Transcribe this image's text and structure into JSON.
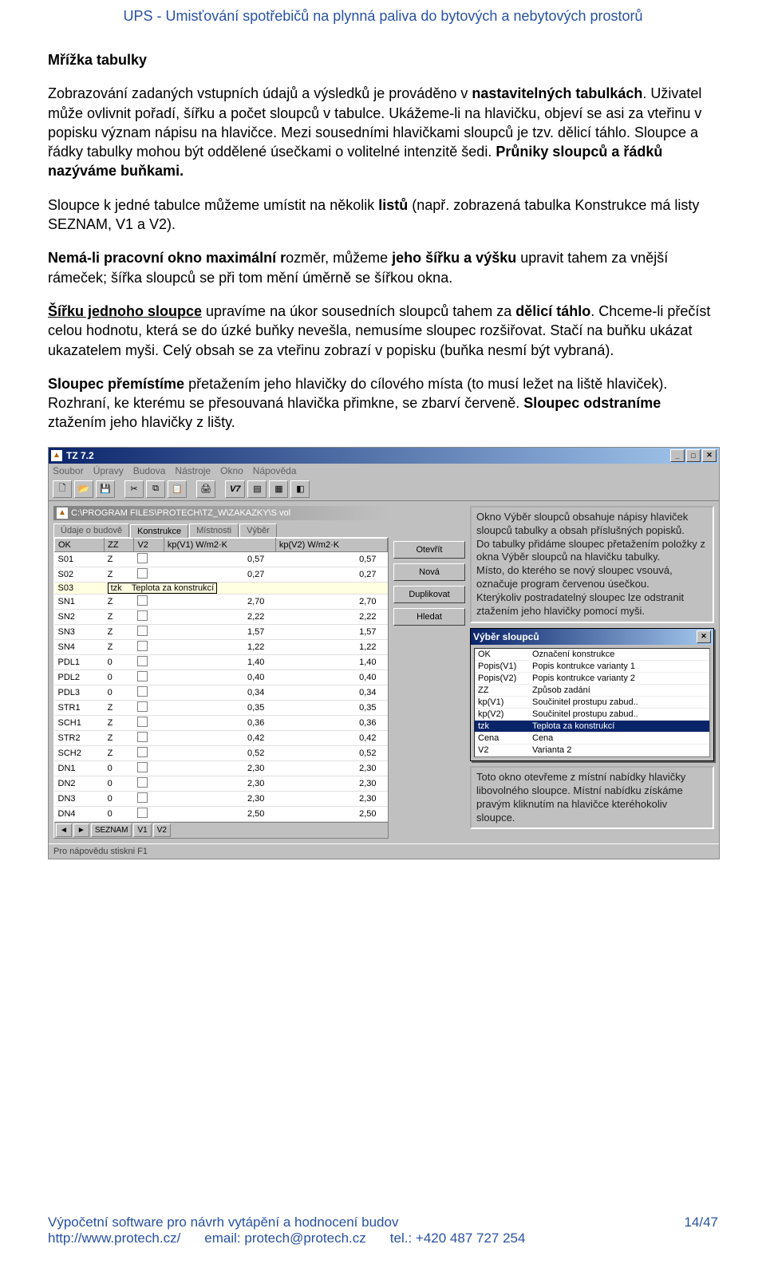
{
  "header": "UPS - Umisťování spotřebičů na plynná paliva do bytových a nebytových prostorů",
  "heading": "Mřížka  tabulky",
  "p1a": "Zobrazování zadaných vstupních údajů a výsledků je prováděno v ",
  "p1b": "nastavitelných tabulkách",
  "p1c": ". Uživatel  může ovlivnit pořadí, šířku a počet sloupců v tabulce. Ukážeme-li na hlavičku, objeví se asi za vteřinu v popisku význam nápisu na hlavičce. Mezi sousedními hlavičkami sloupců je tzv. dělicí táhlo. Sloupce a řádky tabulky mohou být oddělené úsečkami o volitelné intenzitě šedi. ",
  "p1d": "Průniky sloupců a řádků nazýváme buňkami.",
  "p2a": "Sloupce k jedné tabulce můžeme umístit na několik ",
  "p2b": "listů",
  "p2c": " (např. zobrazená tabulka Konstrukce má listy SEZNAM, V1 a V2).",
  "p3a": "Nemá-li pracovní okno maximální r",
  "p3b": "ozměr, můžeme ",
  "p3c": "jeho šířku a výšku",
  "p3d": " upravit tahem za vnější rámeček; šířka sloupců se při tom mění úměrně se šířkou okna.",
  "p4a": "Šířku jednoho sloupce",
  "p4b": " upravíme na úkor sousedních sloupců tahem za ",
  "p4c": "dělicí táhlo",
  "p4d": ". Chceme-li přečíst celou hodnotu, která se do úzké buňky nevešla, nemusíme sloupec rozšiřovat. Stačí   na buňku ukázat ukazatelem myši. Celý obsah se za vteřinu zobrazí v popisku (buňka nesmí být vybraná).",
  "p5a": "Sloupec přemístíme",
  "p5b": " přetažením jeho hlavičky do cílového místa (to musí ležet na liště hlaviček). Rozhraní, ke kterému se přesouvaná hlavička přimkne, se zbarví červeně. ",
  "p5c": "Sloupec odstraníme",
  "p5d": " ztažením jeho hlavičky z lišty.",
  "app": {
    "title": "TZ 7.2",
    "menus": [
      "Soubor",
      "Úpravy",
      "Budova",
      "Nástroje",
      "Okno",
      "Nápověda"
    ],
    "v7": "V7",
    "path": "C:\\PROGRAM FILES\\PROTECH\\TZ_W\\ZAKAZKY\\S vol",
    "tabs": [
      "Údaje o budově",
      "Konstrukce",
      "Místnosti",
      "Výběr"
    ],
    "cols": [
      "OK",
      "ZZ",
      "V2",
      "kp(V1)\nW/m2·K",
      "kp(V2)\nW/m2·K"
    ],
    "rows": [
      [
        "S01",
        "Z",
        "",
        "0,57",
        "0,57"
      ],
      [
        "S02",
        "Z",
        "",
        "0,27",
        "0,27"
      ],
      [
        "S03",
        "tzk_tooltip",
        "",
        "",
        ""
      ],
      [
        "SN1",
        "Z",
        "",
        "2,70",
        "2,70"
      ],
      [
        "SN2",
        "Z",
        "",
        "2,22",
        "2,22"
      ],
      [
        "SN3",
        "Z",
        "",
        "1,57",
        "1,57"
      ],
      [
        "SN4",
        "Z",
        "",
        "1,22",
        "1,22"
      ],
      [
        "PDL1",
        "0",
        "",
        "1,40",
        "1,40"
      ],
      [
        "PDL2",
        "0",
        "",
        "0,40",
        "0,40"
      ],
      [
        "PDL3",
        "0",
        "",
        "0,34",
        "0,34"
      ],
      [
        "STR1",
        "Z",
        "",
        "0,35",
        "0,35"
      ],
      [
        "SCH1",
        "Z",
        "",
        "0,36",
        "0,36"
      ],
      [
        "STR2",
        "Z",
        "",
        "0,42",
        "0,42"
      ],
      [
        "SCH2",
        "Z",
        "",
        "0,52",
        "0,52"
      ],
      [
        "DN1",
        "0",
        "",
        "2,30",
        "2,30"
      ],
      [
        "DN2",
        "0",
        "",
        "2,30",
        "2,30"
      ],
      [
        "DN3",
        "0",
        "",
        "2,30",
        "2,30"
      ],
      [
        "DN4",
        "0",
        "",
        "2,50",
        "2,50"
      ]
    ],
    "tooltip_label": "tzk",
    "tooltip_text": "Teplota za konstrukcí",
    "sheets": [
      "SEZNAM",
      "V1",
      "V2"
    ],
    "buttons": [
      "Otevřít",
      "Nová",
      "Duplikovat",
      "Hledat"
    ],
    "note": "Okno Výběr sloupců obsahuje nápisy hlaviček sloupců tabulky a obsah příslušných popisků.\nDo tabulky přidáme sloupec přetažením položky z okna Výběr sloupců na hlavičku tabulky.\nMísto, do kterého se nový sloupec vsouvá, označuje program červenou úsečkou.\nKterýkoliv postradatelný sloupec lze odstranit ztažením jeho hlavičky pomocí myši.",
    "popup_title": "Výběr sloupců",
    "popup_items": [
      [
        "OK",
        "Označení konstrukce"
      ],
      [
        "Popis(V1)",
        "Popis kontrukce varianty 1"
      ],
      [
        "Popis(V2)",
        "Popis kontrukce varianty 2"
      ],
      [
        "ZZ",
        "Způsob zadání"
      ],
      [
        "kp(V1)",
        "Součinitel prostupu zabud.."
      ],
      [
        "kp(V2)",
        "Součinitel prostupu zabud.."
      ],
      [
        "tzk",
        "Teplota za konstrukcí"
      ],
      [
        "Cena",
        "Cena"
      ],
      [
        "V2",
        "Varianta 2"
      ]
    ],
    "popup_sel": "tzk",
    "note2": "Toto okno otevřeme z místní nabídky hlavičky libovolného sloupce. Místní nabídku získáme pravým kliknutím na hlavičce kteréhokoliv sloupce.",
    "status": "Pro nápovědu stiskni  F1"
  },
  "footer": {
    "l1": "Výpočetní software pro návrh vytápění a hodnocení budov",
    "url": "http://www.protech.cz/",
    "email": "email: protech@protech.cz",
    "tel": "tel.: +420 487 727 254",
    "page": "14/47"
  }
}
